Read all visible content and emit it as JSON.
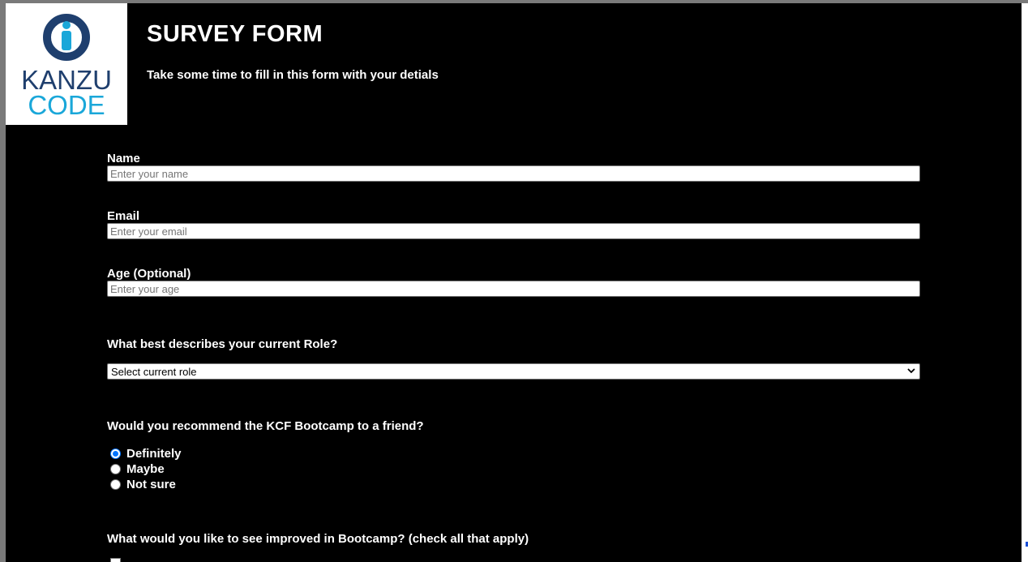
{
  "header": {
    "logo_top": "KANZU",
    "logo_bottom": "CODE",
    "title": "SURVEY FORM",
    "description": "Take some time to fill in this form with your detials"
  },
  "form": {
    "name": {
      "label": "Name",
      "placeholder": "Enter your name",
      "value": ""
    },
    "email": {
      "label": "Email",
      "placeholder": "Enter your email",
      "value": ""
    },
    "age": {
      "label": "Age (Optional)",
      "placeholder": "Enter your age",
      "value": ""
    },
    "role": {
      "question": "What best describes your current Role?",
      "selected": "Select current role",
      "chevron_icon": "chevron-down-icon"
    },
    "recommend": {
      "question": "Would you recommend the KCF Bootcamp to a friend?",
      "options": [
        "Definitely",
        "Maybe",
        "Not sure"
      ],
      "selected": "Definitely"
    },
    "improve": {
      "question": "What would you like to see improved in Bootcamp? (check all that apply)"
    }
  },
  "colors": {
    "background": "#000000",
    "text": "#ffffff",
    "logo_dark": "#1f3f6e",
    "logo_light": "#1aa7d9",
    "radio_accent": "#0075ff"
  }
}
